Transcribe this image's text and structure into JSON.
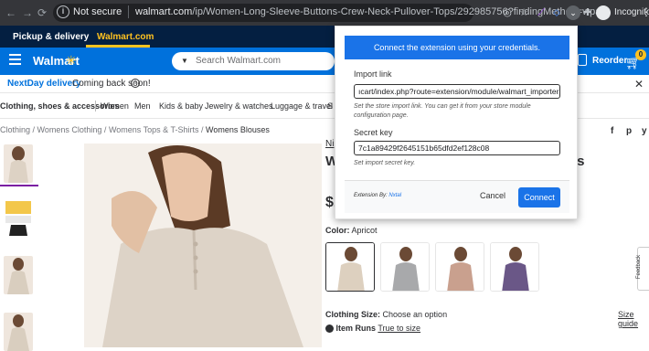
{
  "browser": {
    "not_secure": "Not secure",
    "url_host": "walmart.com",
    "url_path": "/ip/Women-Long-Sleeve-Buttons-Crew-Neck-Pullover-Tops/292985756?findingMethod=wpa",
    "incognito_label": "Incognito"
  },
  "walmart": {
    "subnav": [
      "Pickup & delivery",
      "Walmart.com"
    ],
    "logo": "Walmart",
    "search_placeholder": "Search Walmart.com",
    "reorder": "Reorder",
    "cart_count": "0",
    "banner_title": "NextDay delivery",
    "banner_msg": "Coming back soon!",
    "categories": [
      "Clothing, shoes & accessories",
      "Women",
      "Men",
      "Kids & baby",
      "Jewelry & watches",
      "Luggage & travel",
      "S"
    ],
    "breadcrumbs": [
      "Clothing",
      "Womens Clothing",
      "Womens Tops & T-Shirts",
      "Womens Blouses"
    ],
    "brand_link": "Ni",
    "title_start": "W",
    "title_end": "ps",
    "price_start": "$1",
    "color_label": "Color:",
    "color_value": "Apricot",
    "size_label": "Clothing Size:",
    "size_value": "Choose an option",
    "size_guide": "Size guide",
    "item_runs": "Item Runs",
    "true_to_size": "True to size",
    "feedback": "Feedback"
  },
  "extension": {
    "header": "Connect the extension using your credentials.",
    "import_link_label": "Import link",
    "import_link_value": "ıcart/index.php?route=extension/module/walmart_importer",
    "import_link_help": "Set the store import link. You can get it from your store module configuration page.",
    "secret_key_label": "Secret key",
    "secret_key_value": "7c1a89429f2645151b65dfd2ef128c08",
    "secret_key_help": "Set import secret key.",
    "byline": "Extension By:",
    "byline_link": "Nxtal",
    "cancel": "Cancel",
    "connect": "Connect"
  },
  "colors": {
    "walmart_blue": "#0071dc",
    "walmart_navy": "#041f41",
    "walmart_yellow": "#ffc220",
    "ext_blue": "#1a73e8"
  }
}
